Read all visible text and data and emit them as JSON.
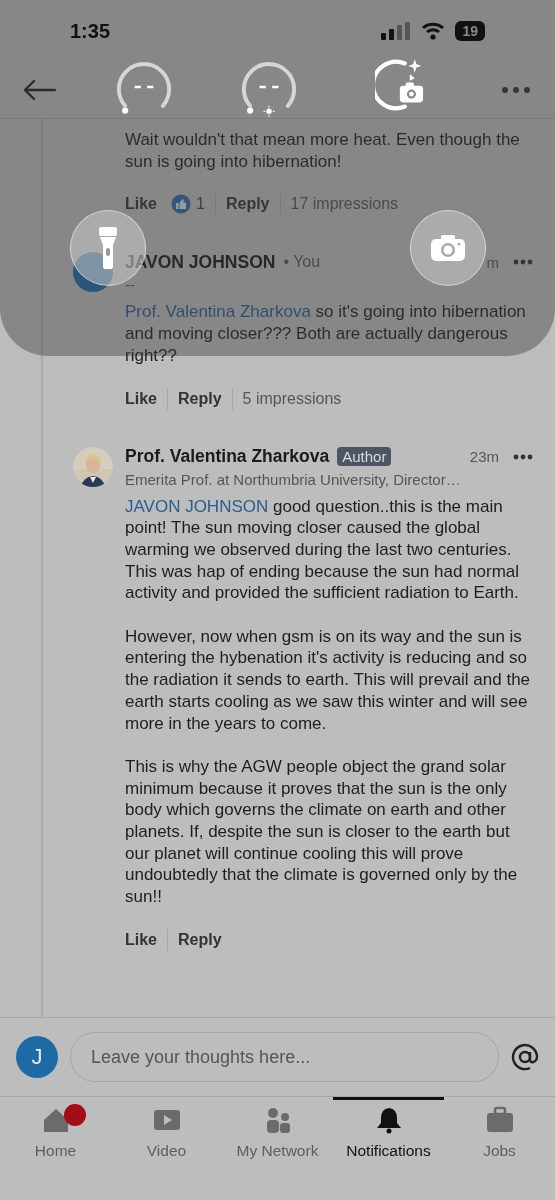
{
  "status_bar": {
    "time": "1:35",
    "battery": "19"
  },
  "comments": [
    {
      "kind": "tail",
      "text": "Wait wouldn't that mean more heat. Even though the sun is going into hibernation!",
      "actions": {
        "like": "Like",
        "reaction_count": "1",
        "reply": "Reply",
        "impressions": "17 impressions"
      }
    },
    {
      "kind": "reply",
      "author": "JAVON JOHNSON",
      "you_tag": "• You",
      "headline": "--",
      "time": "m",
      "mention": "Prof. Valentina Zharkova",
      "paragraphs": [
        " so it's going into hibernation and moving closer??? Both are actually dangerous right??"
      ],
      "actions": {
        "like": "Like",
        "reply": "Reply",
        "impressions": "5 impressions"
      }
    },
    {
      "kind": "reply",
      "author": "Prof. Valentina Zharkova",
      "badge": "Author",
      "time": "23m",
      "headline": "Emerita Prof. at Northumbria University, Director…",
      "mention": "JAVON JOHNSON",
      "paragraphs": [
        " good question..this is the main point! The sun moving closer caused the global warming we observed during the last two centuries.\nThis was hap of ending because the sun had normal activity and provided the sufficient radiation to Earth.",
        "However, now when gsm is on its way and the sun is entering the hybenation it's activity is reducing and so the radiation it sends to earth. This will prevail and the earth starts cooling as we saw this winter and will see more in the years to come.",
        "This is why the AGW people object the grand solar minimum because it proves that the sun is the only body which governs the climate on earth and other planets. If, despite the sun is closer to the earth but our planet will continue cooling this will prove undoubtedly that the climate is governed only by the sun!!"
      ],
      "actions": {
        "like": "Like",
        "reply": "Reply"
      }
    }
  ],
  "composer": {
    "avatar_letter": "J",
    "placeholder": "Leave your thoughts here..."
  },
  "tab_bar": [
    {
      "label": "Home",
      "selected": false,
      "badge": true
    },
    {
      "label": "Video",
      "selected": false,
      "badge": false
    },
    {
      "label": "My Network",
      "selected": false,
      "badge": false
    },
    {
      "label": "Notifications",
      "selected": true,
      "badge": false
    },
    {
      "label": "Jobs",
      "selected": false,
      "badge": false
    }
  ]
}
